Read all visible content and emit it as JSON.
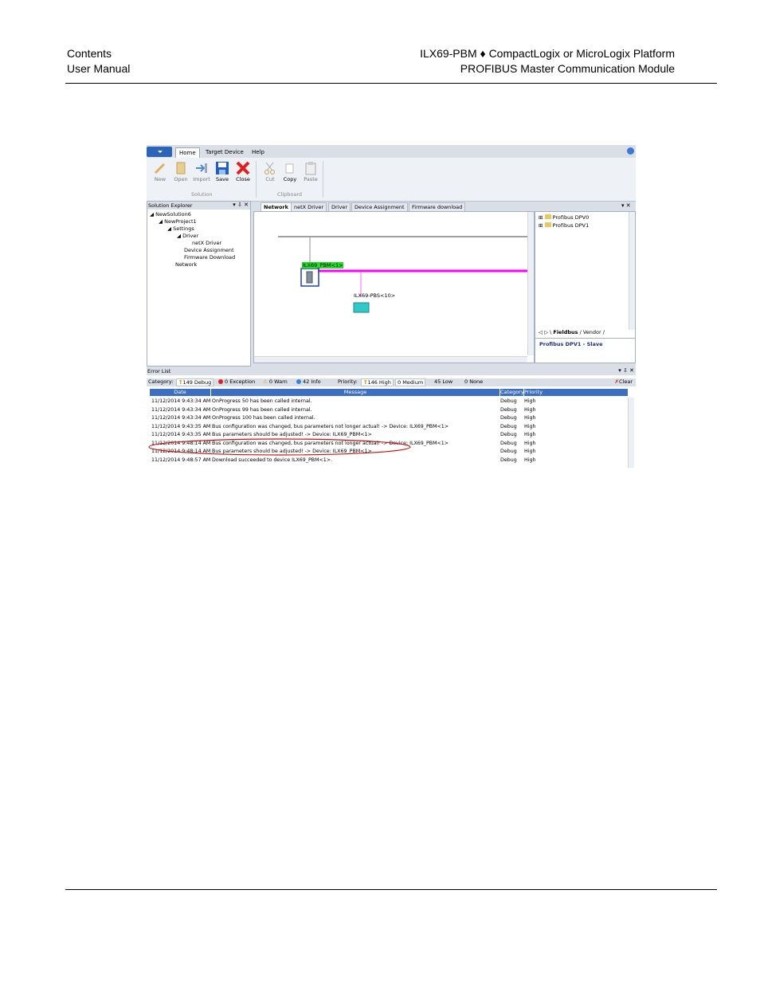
{
  "header": {
    "left_line1": "Contents",
    "left_line2": "User Manual",
    "right_line1": "ILX69-PBM ♦ CompactLogix or MicroLogix Platform",
    "right_line2": "PROFIBUS Master Communication Module"
  },
  "app": {
    "tabs": [
      "Home",
      "Target Device",
      "Help"
    ],
    "ribbon": {
      "buttons": [
        "New",
        "Open",
        "Import",
        "Save",
        "Close",
        "Cut",
        "Copy",
        "Paste"
      ],
      "groups": [
        "Solution",
        "Clipboard"
      ]
    },
    "solution_explorer": {
      "title": "Solution Explorer",
      "items": [
        "NewSolution6",
        "NewProject1",
        "Settings",
        "Driver",
        "netX Driver",
        "Device Assignment",
        "Firmware Download",
        "Network"
      ]
    },
    "doc_tabs": [
      "Network",
      "netX Driver",
      "Driver",
      "Device Assignment",
      "Firmware download"
    ],
    "network": {
      "master_label": "ILX69_PBM<1>",
      "slave_label": "ILX69-PBS<10>"
    },
    "catalog": {
      "items": [
        "Profibus DPV0",
        "Profibus DPV1"
      ],
      "tabs": [
        "Fieldbus",
        "Vendor"
      ],
      "selection": "Profibus DPV1 - Slave"
    },
    "error_list": {
      "title": "Error List",
      "category_label": "Category:",
      "filters": [
        "149 Debug",
        "0 Exception",
        "0 Warn",
        "42 Info"
      ],
      "priority_label": "Priority:",
      "priority_filters": [
        "146 High",
        "0 Medium",
        "45 Low",
        "0 None"
      ],
      "clear_label": "Clear",
      "columns": [
        "Date",
        "Message",
        "Category",
        "Priority"
      ],
      "rows": [
        {
          "date": "11/12/2014 9:43:34 AM",
          "message": "OnProgress 50 has been called internal.",
          "category": "Debug",
          "priority": "High"
        },
        {
          "date": "11/12/2014 9:43:34 AM",
          "message": "OnProgress 99 has been called internal.",
          "category": "Debug",
          "priority": "High"
        },
        {
          "date": "11/12/2014 9:43:34 AM",
          "message": "OnProgress 100 has been called internal.",
          "category": "Debug",
          "priority": "High"
        },
        {
          "date": "11/12/2014 9:43:35 AM",
          "message": "Bus configuration was changed, bus parameters not longer actual! -> Device: ILX69_PBM<1>",
          "category": "Debug",
          "priority": "High"
        },
        {
          "date": "11/12/2014 9:43:35 AM",
          "message": "Bus parameters should be adjusted! -> Device: ILX69_PBM<1>",
          "category": "Debug",
          "priority": "High"
        },
        {
          "date": "11/12/2014 9:48:14 AM",
          "message": "Bus configuration was changed, bus parameters not longer actual! -> Device: ILX69_PBM<1>",
          "category": "Debug",
          "priority": "High"
        },
        {
          "date": "11/12/2014 9:48:14 AM",
          "message": "Bus parameters should be adjusted! -> Device: ILX69_PBM<1>",
          "category": "Debug",
          "priority": "High"
        },
        {
          "date": "11/12/2014 9:48:57 AM",
          "message": "Download succeeded to device ILX69_PBM<1>.",
          "category": "Debug",
          "priority": "High"
        }
      ]
    }
  }
}
